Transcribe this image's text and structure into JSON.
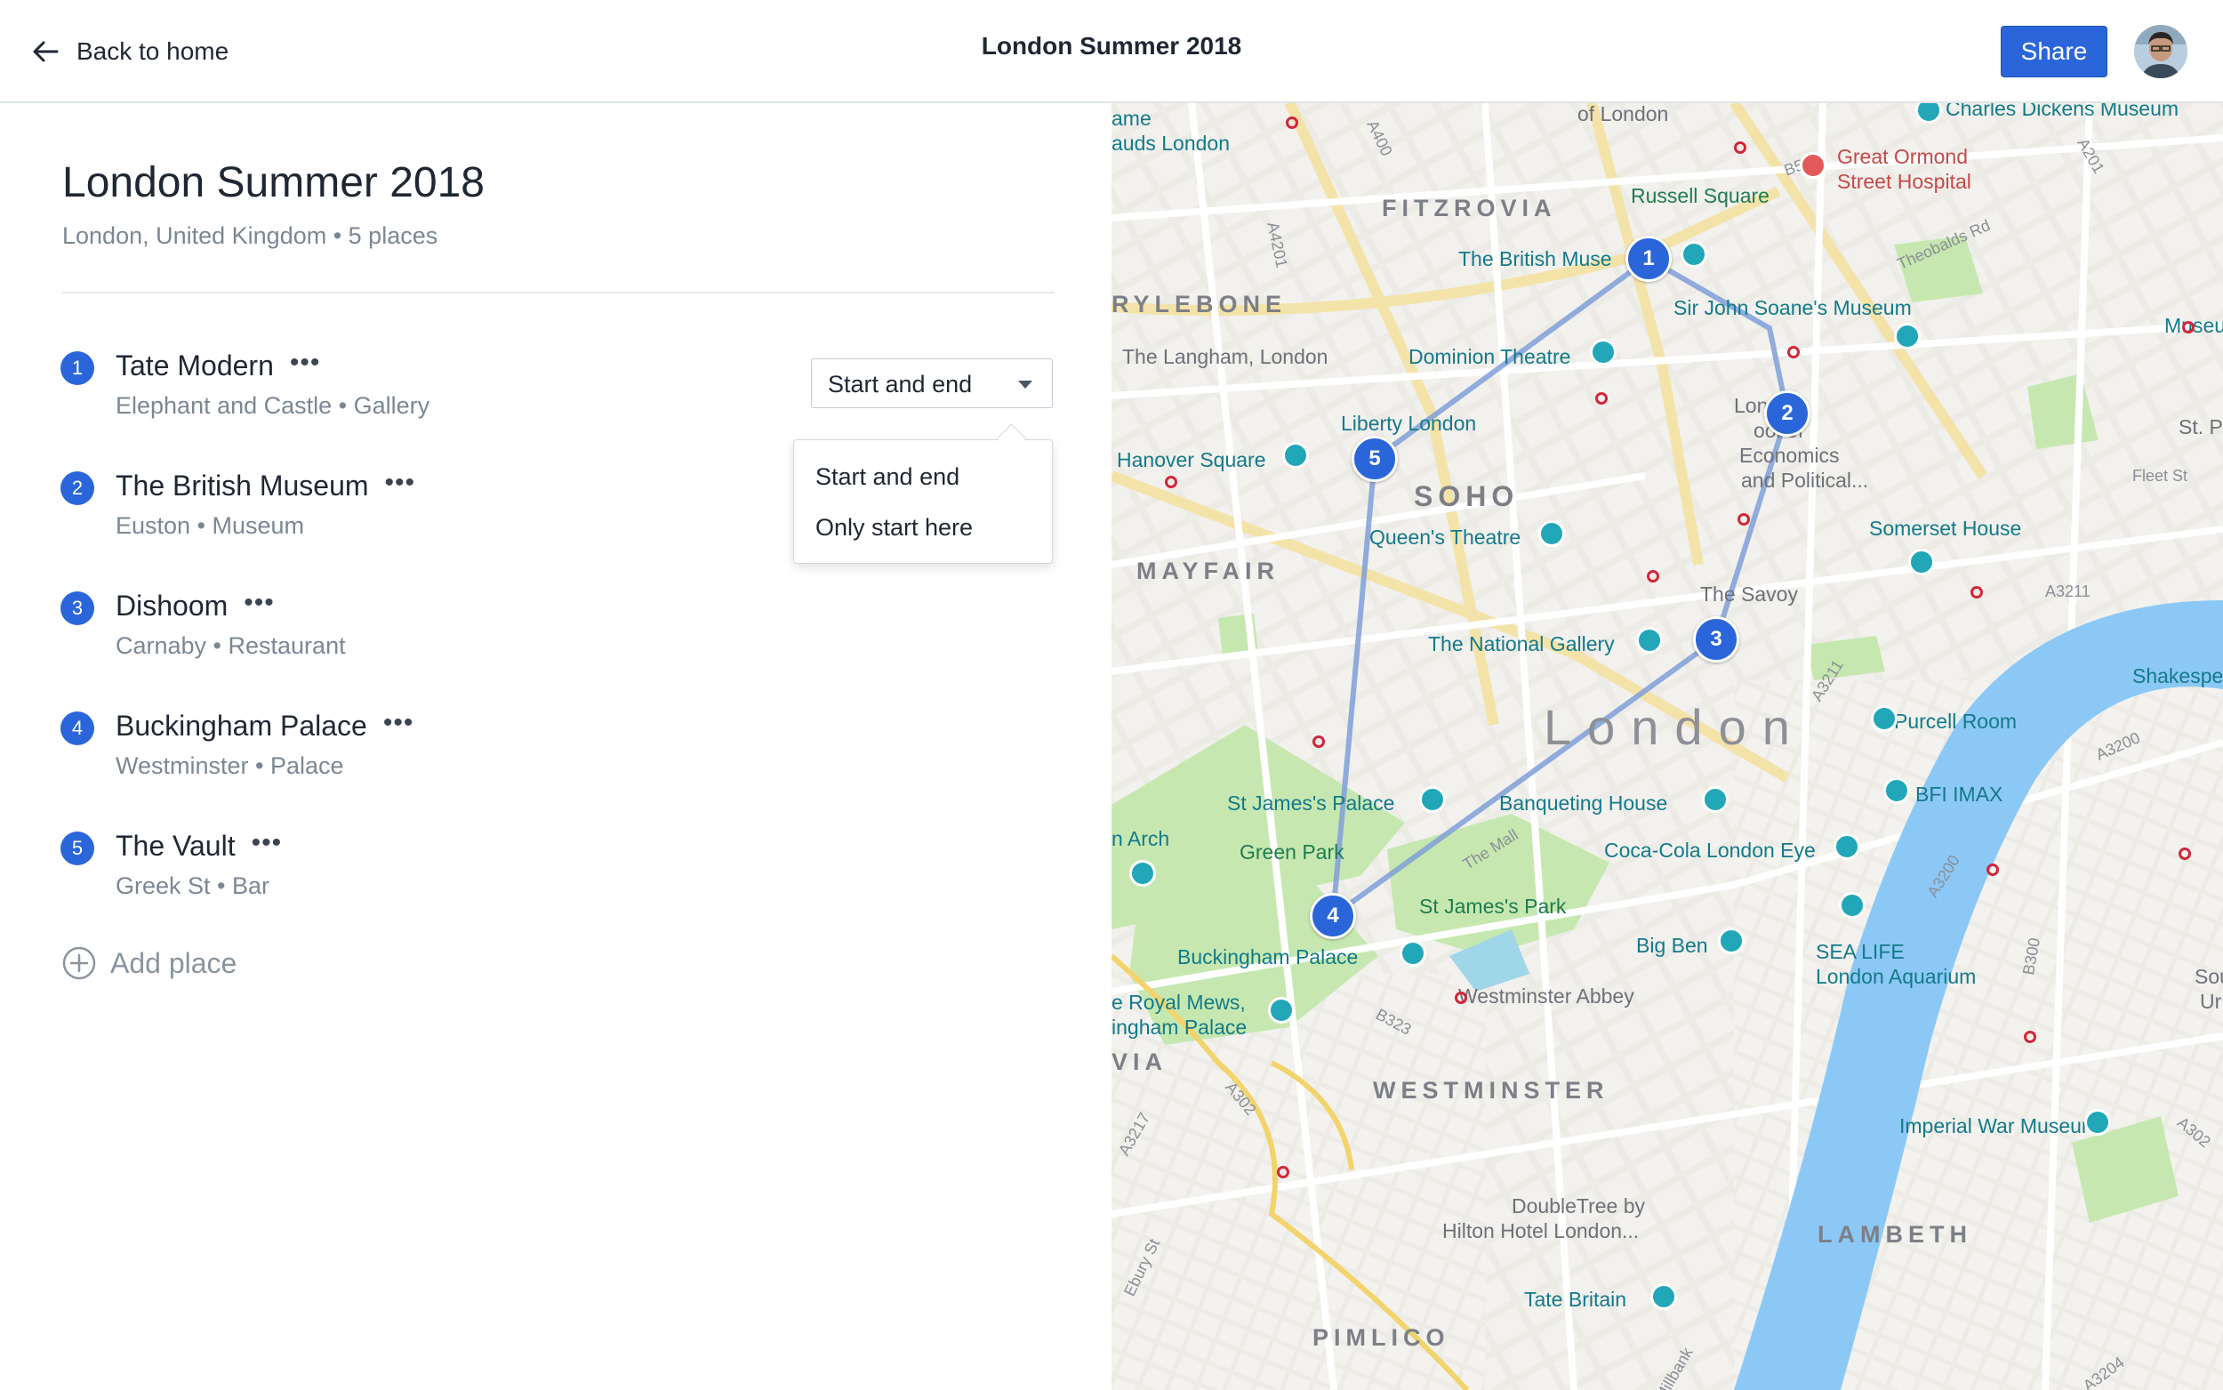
{
  "header": {
    "back_label": "Back to home",
    "title": "London Summer 2018",
    "share_label": "Share"
  },
  "trip": {
    "title": "London Summer 2018",
    "subtitle": "London, United Kingdom • 5 places"
  },
  "places": [
    {
      "number": "1",
      "name": "Tate Modern",
      "meta": "Elephant and Castle • Gallery"
    },
    {
      "number": "2",
      "name": "The British Museum",
      "meta": "Euston • Museum"
    },
    {
      "number": "3",
      "name": "Dishoom",
      "meta": "Carnaby • Restaurant"
    },
    {
      "number": "4",
      "name": "Buckingham Palace",
      "meta": "Westminster • Palace"
    },
    {
      "number": "5",
      "name": "The Vault",
      "meta": "Greek St • Bar"
    }
  ],
  "more_glyph": "•••",
  "add_place_label": "Add place",
  "route_select": {
    "value": "Start and end",
    "options": [
      "Start and end",
      "Only start here"
    ]
  },
  "map": {
    "markers": [
      "1",
      "2",
      "3",
      "4",
      "5"
    ],
    "labels": {
      "fitzrovia": "FITZROVIA",
      "marylebone": "RYLEBONE",
      "soho": "SOHO",
      "mayfair": "MAYFAIR",
      "westminster": "WESTMINSTER",
      "lambeth": "LAMBETH",
      "pimlico": "PIMLICO",
      "london": "London",
      "russell_square": "Russell Square",
      "british_museum": "The British Muse",
      "soane": "Sir John Soane's Museum",
      "langham": "The Langham, London",
      "dominion": "Dominion Theatre",
      "liberty": "Liberty London",
      "hanover": "Hanover Square",
      "queens_theatre": "Queen's Theatre",
      "lse_1": "London",
      "lse_2": "ool of",
      "lse_3": "Economics",
      "lse_4": "and Political...",
      "somerset": "Somerset House",
      "savoy": "The Savoy",
      "national_gallery": "The National Gallery",
      "purcell": "Purcell Room",
      "bfi": "BFI IMAX",
      "st_james_palace": "St James's Palace",
      "banqueting": "Banqueting House",
      "green_park": "Green Park",
      "coca_cola": "Coca-Cola London Eye",
      "st_james_park": "St James's Park",
      "big_ben": "Big Ben",
      "sea_life_1": "SEA LIFE",
      "sea_life_2": "London Aquarium",
      "buckingham": "Buckingham Palace",
      "royal_mews_1": "e Royal Mews,",
      "royal_mews_2": "ingham Palace",
      "westminster_abbey": "Westminster Abbey",
      "imperial_war": "Imperial War Museum",
      "doubletree_1": "DoubleTree by",
      "doubletree_2": "Hilton Hotel London...",
      "tate_britain": "Tate Britain",
      "charles_dickens": "Charles Dickens Museum",
      "great_ormond_1": "Great Ormond",
      "great_ormond_2": "Street Hospital",
      "of_london": "of London",
      "ame": "ame",
      "auds": "auds London",
      "museu": "Museu",
      "st_p": "St. P",
      "shakespe": "Shakespe",
      "arch": "n Arch",
      "via": "VIA",
      "sou": "Sou",
      "ur": "Ur",
      "fleet_st": "Fleet St",
      "theobalds": "Theobalds Rd",
      "the_mall": "The Mall",
      "a400": "A400",
      "b502": "B502",
      "a201": "A201",
      "a4201": "A4201",
      "a3211": "A3211",
      "a3211b": "A3211",
      "a3200": "A3200",
      "a3200b": "A3200",
      "b300": "B300",
      "b323": "B323",
      "a302": "A302",
      "a3217": "A3217",
      "a302b": "A302",
      "a3204": "A3204",
      "ebury": "Ebury St",
      "millbank": "Millbank"
    }
  },
  "colors": {
    "accent": "#2a66d9",
    "route": "#7f9fd8",
    "river": "#8cc8f5",
    "park": "#c6e8b0",
    "poi": "#21a7b8"
  },
  "icons": {
    "back": "arrow-left-icon",
    "more": "more-horizontal-icon",
    "add": "plus-circle-icon",
    "caret": "caret-down-icon",
    "locate": "my-location-icon",
    "zoom_in": "plus-icon",
    "zoom_out": "minus-icon"
  }
}
